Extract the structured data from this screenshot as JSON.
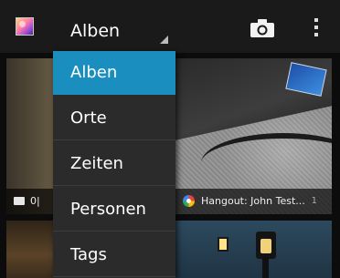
{
  "actionbar": {
    "spinner_label": "Alben"
  },
  "dropdown": {
    "items": [
      {
        "label": "Alben",
        "selected": true
      },
      {
        "label": "Orte",
        "selected": false
      },
      {
        "label": "Zeiten",
        "selected": false
      },
      {
        "label": "Personen",
        "selected": false
      },
      {
        "label": "Tags",
        "selected": false
      }
    ]
  },
  "albums": [
    {
      "caption": "0|",
      "icon": "folder-icon"
    },
    {
      "caption": "Hangout: John Test...",
      "count": "1",
      "icon": "hangout-icon"
    },
    {
      "caption": ""
    },
    {
      "caption": ""
    }
  ],
  "colors": {
    "accent": "#1a8fbf",
    "actionbar": "#1a1a1a",
    "dropdown_bg": "#2b2b2b"
  }
}
